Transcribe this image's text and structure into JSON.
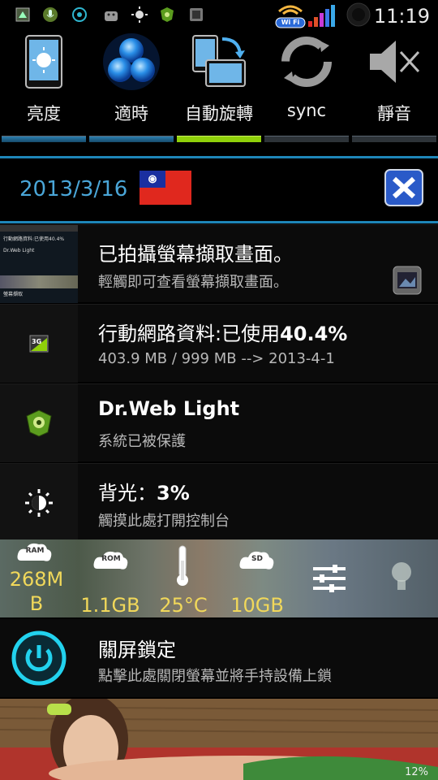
{
  "status_bar": {
    "time": "11:19",
    "wifi_label": "Wi Fi",
    "icons": [
      "launcher-grid-icon",
      "mic-icon",
      "sync-circle-icon",
      "android-icon",
      "brightness-icon",
      "drweb-icon",
      "screenshot-icon"
    ]
  },
  "toggles": [
    {
      "label": "亮度",
      "icon": "brightness-tablet-icon",
      "level": 0.35
    },
    {
      "label": "適時",
      "icon": "auto-timeout-icon",
      "level": 1.0
    },
    {
      "label": "自動旋轉",
      "icon": "auto-rotate-icon",
      "level": 1.0
    },
    {
      "label": "sync",
      "icon": "sync-icon",
      "level": 0
    },
    {
      "label": "靜音",
      "icon": "mute-speaker-icon",
      "level": 0
    }
  ],
  "date_row": {
    "date": "2013/3/16",
    "flag": "roc-flag-icon",
    "close": "close-x-icon"
  },
  "notifications": [
    {
      "title": "已拍攝螢幕擷取畫面。",
      "subtitle": "輕觸即可查看螢幕擷取畫面。",
      "thumb": {
        "app_name": "Dr.Web Light",
        "line1": "行動網路資料:已使用40.4%",
        "line2": "螢幕擷取"
      }
    },
    {
      "title_prefix": "行動網路資料:已使用",
      "title_bold": "40.4%",
      "subtitle": "403.9 MB / 999 MB --> 2013-4-1",
      "icon": "3g-icon"
    },
    {
      "title": "Dr.Web Light",
      "subtitle": "系統已被保護",
      "icon": "drweb-shield-icon"
    },
    {
      "title_prefix": "背光：",
      "title_bold": "3%",
      "subtitle": "觸摸此處打開控制台",
      "icon": "brightness-sun-icon"
    }
  ],
  "stats": {
    "ram_label": "RAM",
    "ram_value_line1": "268M",
    "ram_value_line2": "B",
    "rom_label": "ROM",
    "rom_value": "1.1GB",
    "temp_value": "25°C",
    "sd_label": "SD",
    "sd_value": "10GB",
    "accent": "#f1d85a"
  },
  "lock": {
    "title": "關屏鎖定",
    "subtitle": "點擊此處關閉螢幕並將手持設備上鎖",
    "icon": "power-icon"
  },
  "footer": {
    "percent": "12%"
  },
  "colors": {
    "accent_blue": "#1e86b8",
    "date_blue": "#4aa6d8",
    "toggle_on": "#8fd00a"
  }
}
